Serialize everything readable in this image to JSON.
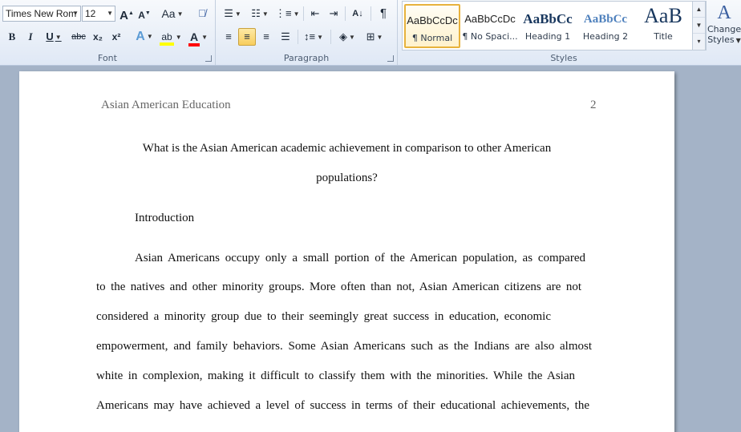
{
  "font": {
    "family_value": "Times New Rom",
    "size_value": "12",
    "grow_label": "A",
    "shrink_label": "A",
    "case_label": "Aa",
    "bold_label": "B",
    "italic_label": "I",
    "underline_label": "U",
    "strike_label": "abc",
    "subscript_label": "x₂",
    "superscript_label": "x²",
    "group_label": "Font"
  },
  "paragraph": {
    "pilcrow_label": "¶",
    "group_label": "Paragraph"
  },
  "styles": {
    "tiles": [
      {
        "sample": "AaBbCcDc",
        "name": "¶ Normal"
      },
      {
        "sample": "AaBbCcDc",
        "name": "¶ No Spaci..."
      },
      {
        "sample": "AaBbCc",
        "name": "Heading 1"
      },
      {
        "sample": "AaBbCc",
        "name": "Heading 2"
      },
      {
        "sample": "AaB",
        "name": "Title"
      }
    ],
    "group_label": "Styles",
    "change_styles_line1": "Change",
    "change_styles_line2": "Styles"
  },
  "colors": {
    "accent_heading": "#17365d",
    "accent_heading2": "#4f81bd",
    "highlight": "#ffff00",
    "font_color": "#ff0000"
  },
  "document": {
    "header_title": "Asian American Education",
    "page_number": "2",
    "title_line1": "What is the Asian American academic achievement in comparison to other American",
    "title_line2": "populations?",
    "section_heading": "Introduction",
    "paragraph_lines": [
      "Asian Americans occupy only a small portion of the American population, as compared",
      "to the natives and other minority groups. More often than not, Asian American citizens are not",
      "considered a minority group due to their seemingly great success in education, economic",
      "empowerment, and family behaviors. Some Asian Americans such as the Indians are also almost",
      "white in complexion, making it difficult to classify them with the minorities. While the Asian",
      "Americans may have achieved a level of success in terms of their educational achievements, the"
    ]
  }
}
